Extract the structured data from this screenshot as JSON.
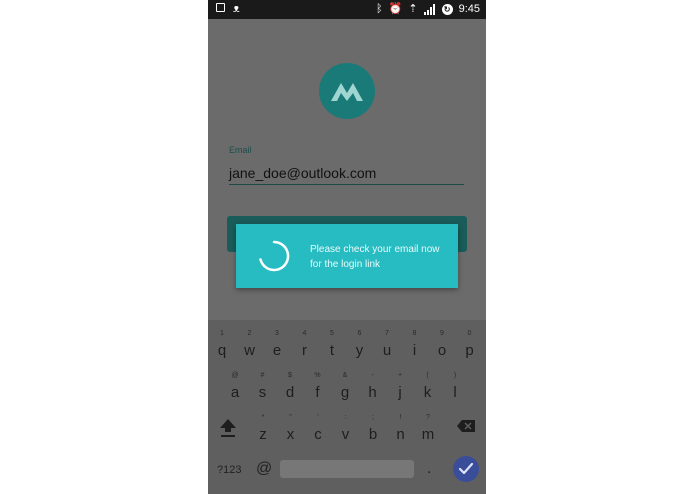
{
  "status_bar": {
    "left_icons": [
      "square-icon",
      "cat-icon"
    ],
    "right_icons": [
      "bluetooth-icon",
      "alarm-icon",
      "wifi-icon",
      "signal-icon",
      "sync-icon"
    ],
    "time": "9:45"
  },
  "app": {
    "logo_letter": "M",
    "email_label": "Email",
    "email_value": "jane_doe@outlook.com",
    "toast_message": "Please check your email now for the login link"
  },
  "keyboard": {
    "row1": [
      {
        "k": "q",
        "h": "1"
      },
      {
        "k": "w",
        "h": "2"
      },
      {
        "k": "e",
        "h": "3"
      },
      {
        "k": "r",
        "h": "4"
      },
      {
        "k": "t",
        "h": "5"
      },
      {
        "k": "y",
        "h": "6"
      },
      {
        "k": "u",
        "h": "7"
      },
      {
        "k": "i",
        "h": "8"
      },
      {
        "k": "o",
        "h": "9"
      },
      {
        "k": "p",
        "h": "0"
      }
    ],
    "row2": [
      {
        "k": "a",
        "h": "@"
      },
      {
        "k": "s",
        "h": "#"
      },
      {
        "k": "d",
        "h": "$"
      },
      {
        "k": "f",
        "h": "%"
      },
      {
        "k": "g",
        "h": "&"
      },
      {
        "k": "h",
        "h": "-"
      },
      {
        "k": "j",
        "h": "+"
      },
      {
        "k": "k",
        "h": "("
      },
      {
        "k": "l",
        "h": ")"
      }
    ],
    "row3": [
      {
        "k": "z",
        "h": "*"
      },
      {
        "k": "x",
        "h": "\""
      },
      {
        "k": "c",
        "h": "'"
      },
      {
        "k": "v",
        "h": ":"
      },
      {
        "k": "b",
        "h": ";"
      },
      {
        "k": "n",
        "h": "!"
      },
      {
        "k": "m",
        "h": "?"
      }
    ],
    "symbols_label": "?123",
    "at_label": "@",
    "period_label": "."
  },
  "colors": {
    "toast": "#27bcc1",
    "logo": "#197a78",
    "enter": "#3a4d9a"
  }
}
